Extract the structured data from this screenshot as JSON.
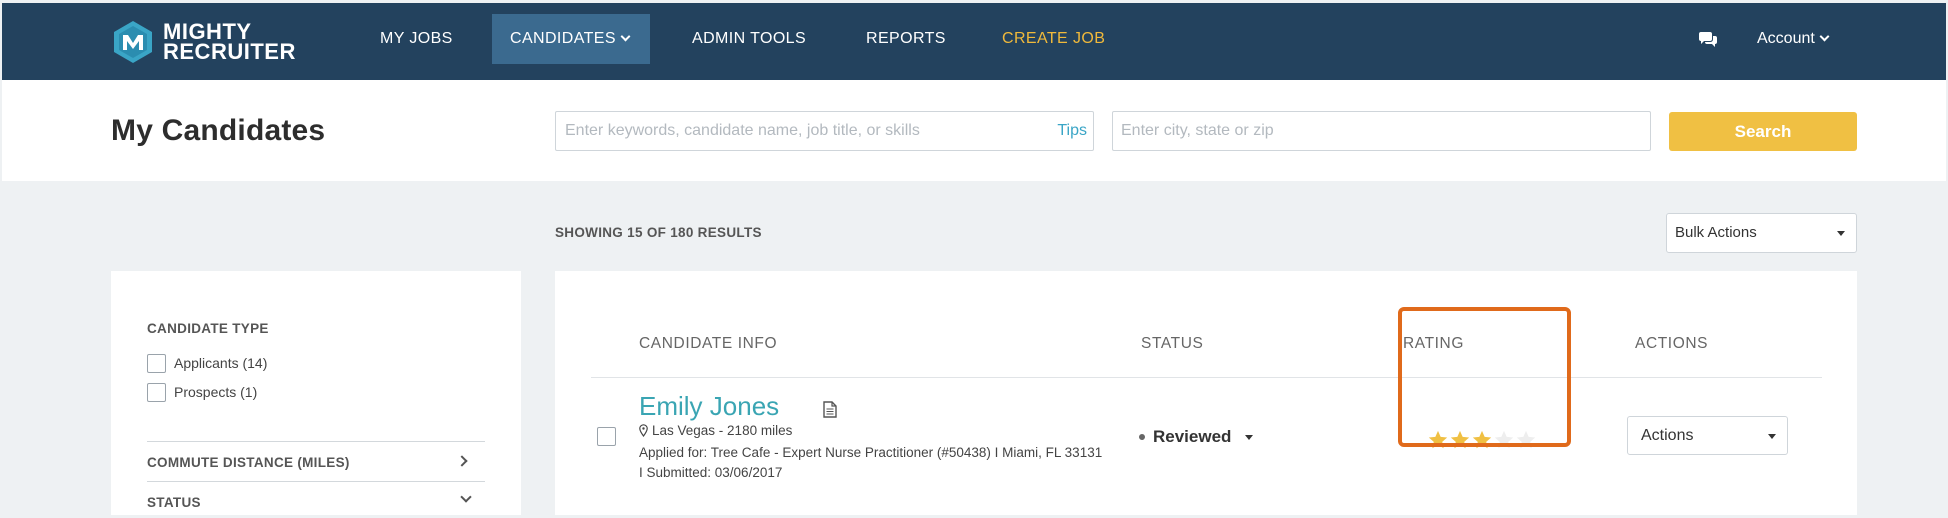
{
  "brand": {
    "line1": "MIGHTY",
    "line2": "RECRUITER"
  },
  "nav": {
    "items": [
      {
        "label": "MY JOBS"
      },
      {
        "label": "CANDIDATES"
      },
      {
        "label": "ADMIN TOOLS"
      },
      {
        "label": "REPORTS"
      },
      {
        "label": "CREATE JOB"
      }
    ],
    "active": "CANDIDATES",
    "account_label": "Account"
  },
  "header": {
    "title": "My Candidates",
    "keywords_placeholder": "Enter keywords, candidate name, job title, or skills",
    "tips_label": "Tips",
    "location_placeholder": "Enter city, state or zip",
    "search_label": "Search"
  },
  "results": {
    "summary": "SHOWING 15 OF 180 RESULTS",
    "bulk_actions_label": "Bulk Actions"
  },
  "sidebar": {
    "candidate_type_heading": "CANDIDATE TYPE",
    "candidate_types": [
      {
        "label": "Applicants (14)",
        "checked": false
      },
      {
        "label": "Prospects (1)",
        "checked": false
      }
    ],
    "commute_heading": "COMMUTE DISTANCE (MILES)",
    "status_heading": "STATUS"
  },
  "table": {
    "columns": {
      "info": "CANDIDATE INFO",
      "status": "STATUS",
      "rating": "RATING",
      "actions": "ACTIONS"
    },
    "rows": [
      {
        "name": "Emily Jones",
        "location": "Las Vegas - 2180 miles",
        "applied": "Applied for: Tree Cafe - Expert Nurse Practitioner (#50438)  I  Miami, FL 33131  I  Submitted: 03/06/2017",
        "status": "Reviewed",
        "rating": 3,
        "rating_max": 5,
        "actions_label": "Actions"
      }
    ]
  },
  "colors": {
    "nav_bg": "#23425e",
    "nav_active": "#3b6a8f",
    "create_job": "#f0b93b",
    "search_button": "#f0c043",
    "candidate_link": "#3aa5b3",
    "star_filled": "#f0c043",
    "star_empty": "#eeeeee",
    "highlight_box": "#e06a1b"
  }
}
